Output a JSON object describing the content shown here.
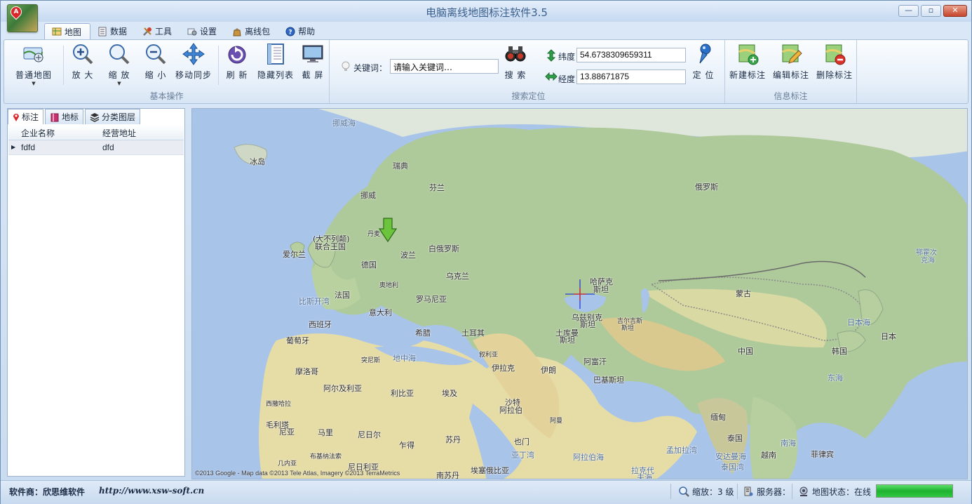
{
  "window": {
    "title": "电脑离线地图标注软件3.5",
    "controls": {
      "minimize": "—",
      "maximize": "▫",
      "close": "✕"
    }
  },
  "menu_tabs": [
    {
      "label": "地图",
      "icon": "map-icon",
      "active": true
    },
    {
      "label": "数据",
      "icon": "data-icon"
    },
    {
      "label": "工具",
      "icon": "tools-icon"
    },
    {
      "label": "设置",
      "icon": "settings-icon"
    },
    {
      "label": "离线包",
      "icon": "package-icon"
    },
    {
      "label": "帮助",
      "icon": "help-icon"
    }
  ],
  "ribbon": {
    "basic": {
      "title": "基本操作",
      "buttons": {
        "normal_map": "普通地图",
        "zoom_in": "放 大",
        "zoom": "缩 放",
        "zoom_out": "缩 小",
        "move_sync": "移动同步",
        "refresh": "刷 新",
        "hide_list": "隐藏列表",
        "screenshot": "截 屏"
      }
    },
    "search": {
      "title": "搜索定位",
      "keyword_label": "关键词：",
      "keyword_value": "请输入关键词…",
      "search_button": "搜 索",
      "lat_label": "纬度",
      "lat_value": "54.6738309659311",
      "lng_label": "经度",
      "lng_value": "13.88671875",
      "locate_button": "定 位"
    },
    "info": {
      "title": "信息标注",
      "buttons": {
        "new": "新建标注",
        "edit": "编辑标注",
        "delete": "删除标注"
      }
    }
  },
  "left_panel": {
    "tabs": [
      "标注",
      "地标",
      "分类图层"
    ],
    "columns": [
      "企业名称",
      "经营地址"
    ],
    "rows": [
      {
        "name": "fdfd",
        "address": "dfd"
      }
    ]
  },
  "map": {
    "labels": {
      "norwegian_sea": "挪威海",
      "iceland": "冰岛",
      "sweden": "瑞典",
      "finland": "芬兰",
      "norway": "挪威",
      "russia": "俄罗斯",
      "denmark": "丹麦",
      "uk_1": "(大不列颠)",
      "uk_2": "联合王国",
      "ireland": "爱尔兰",
      "poland": "波兰",
      "belarus": "白俄罗斯",
      "germany": "德国",
      "ukraine": "乌克兰",
      "kazakhstan_1": "哈萨克",
      "kazakhstan_2": "斯坦",
      "bay_of_biscay": "比斯开湾",
      "france": "法国",
      "austria": "奥地利",
      "romania": "罗马尼亚",
      "uzbekistan_1": "乌兹别克",
      "uzbekistan_2": "斯坦",
      "kyrgyzstan_1": "吉尔吉斯",
      "kyrgyzstan_2": "斯坦",
      "mongolia": "蒙古",
      "sea_of_okhotsk_1": "鄂霍次",
      "sea_of_okhotsk_2": "克海",
      "italy": "意大利",
      "spain": "西班牙",
      "turkmenistan_1": "土库曼",
      "turkmenistan_2": "斯坦",
      "greece": "希腊",
      "turkey": "土耳其",
      "sea_of_japan": "日本海",
      "japan": "日本",
      "portugal": "葡萄牙",
      "china": "中国",
      "korea": "韩国",
      "syria": "叙利亚",
      "tunisia": "突尼斯",
      "mediterranean": "地中海",
      "iraq": "伊拉克",
      "iran": "伊朗",
      "afghanistan": "阿富汗",
      "morocco": "摩洛哥",
      "east_china_sea": "东海",
      "pakistan": "巴基斯坦",
      "algeria": "阿尔及利亚",
      "libya": "利比亚",
      "egypt": "埃及",
      "western_sahara": "西撒哈拉",
      "saudi_1": "沙特",
      "saudi_2": "阿拉伯",
      "oman": "阿曼",
      "myanmar": "缅甸",
      "mauritania_1": "毛利塔",
      "mauritania_2": "尼亚",
      "mali": "马里",
      "niger": "尼日尔",
      "sudan": "苏丹",
      "thailand": "泰国",
      "south_china_sea": "南海",
      "yemen": "也门",
      "chad": "乍得",
      "gulf_of_aden": "亚丁湾",
      "bay_of_bengal": "孟加拉湾",
      "philippines": "菲律宾",
      "vietnam": "越南",
      "andaman_1": "安达曼海",
      "andaman_2": "泰国湾",
      "burkina": "布基纳法索",
      "guinea": "几内亚",
      "arabian_sea": "阿拉伯海",
      "laccadive_1": "拉克代",
      "laccadive_2": "夫海",
      "nigeria": "尼日利亚",
      "south_sudan": "南苏丹",
      "ethiopia": "埃塞俄比亚"
    },
    "attribution": "©2013 Google - Map data ©2013 Tele Atlas, Imagery ©2013 TerraMetrics"
  },
  "status": {
    "vendor": "软件商：欣思维软件",
    "url": "http://www.xsw-soft.cn",
    "zoom": "缩放：3 级",
    "server": "服务器：",
    "map_status": "地图状态：在线",
    "progress": 1.0
  }
}
